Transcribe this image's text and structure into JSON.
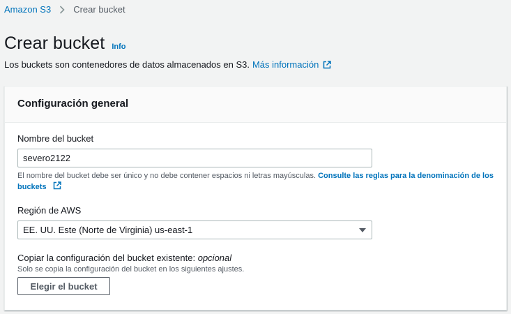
{
  "breadcrumb": {
    "root": "Amazon S3",
    "current": "Crear bucket"
  },
  "header": {
    "title": "Crear bucket",
    "info": "Info",
    "description": "Los buckets son contenedores de datos almacenados en S3.",
    "more_link": "Más información"
  },
  "panel": {
    "title": "Configuración general",
    "bucket_name": {
      "label": "Nombre del bucket",
      "value": "severo2122",
      "hint": "El nombre del bucket debe ser único y no debe contener espacios ni letras mayúsculas.",
      "rules_link": "Consulte las reglas para la denominación de los buckets"
    },
    "region": {
      "label": "Región de AWS",
      "value": "EE. UU. Este (Norte de Virginia) us-east-1"
    },
    "copy": {
      "label": "Copiar la configuración del bucket existente:",
      "optional": "opcional",
      "description": "Solo se copia la configuración del bucket en los siguientes ajustes.",
      "button": "Elegir el bucket"
    }
  },
  "colors": {
    "link": "#0073bb",
    "text": "#16191f",
    "muted": "#545b64",
    "background": "#f2f3f3",
    "border": "#aab7b8"
  },
  "icons": {
    "separator": "chevron-right-icon",
    "external": "external-link-icon",
    "dropdown": "caret-down-icon"
  }
}
